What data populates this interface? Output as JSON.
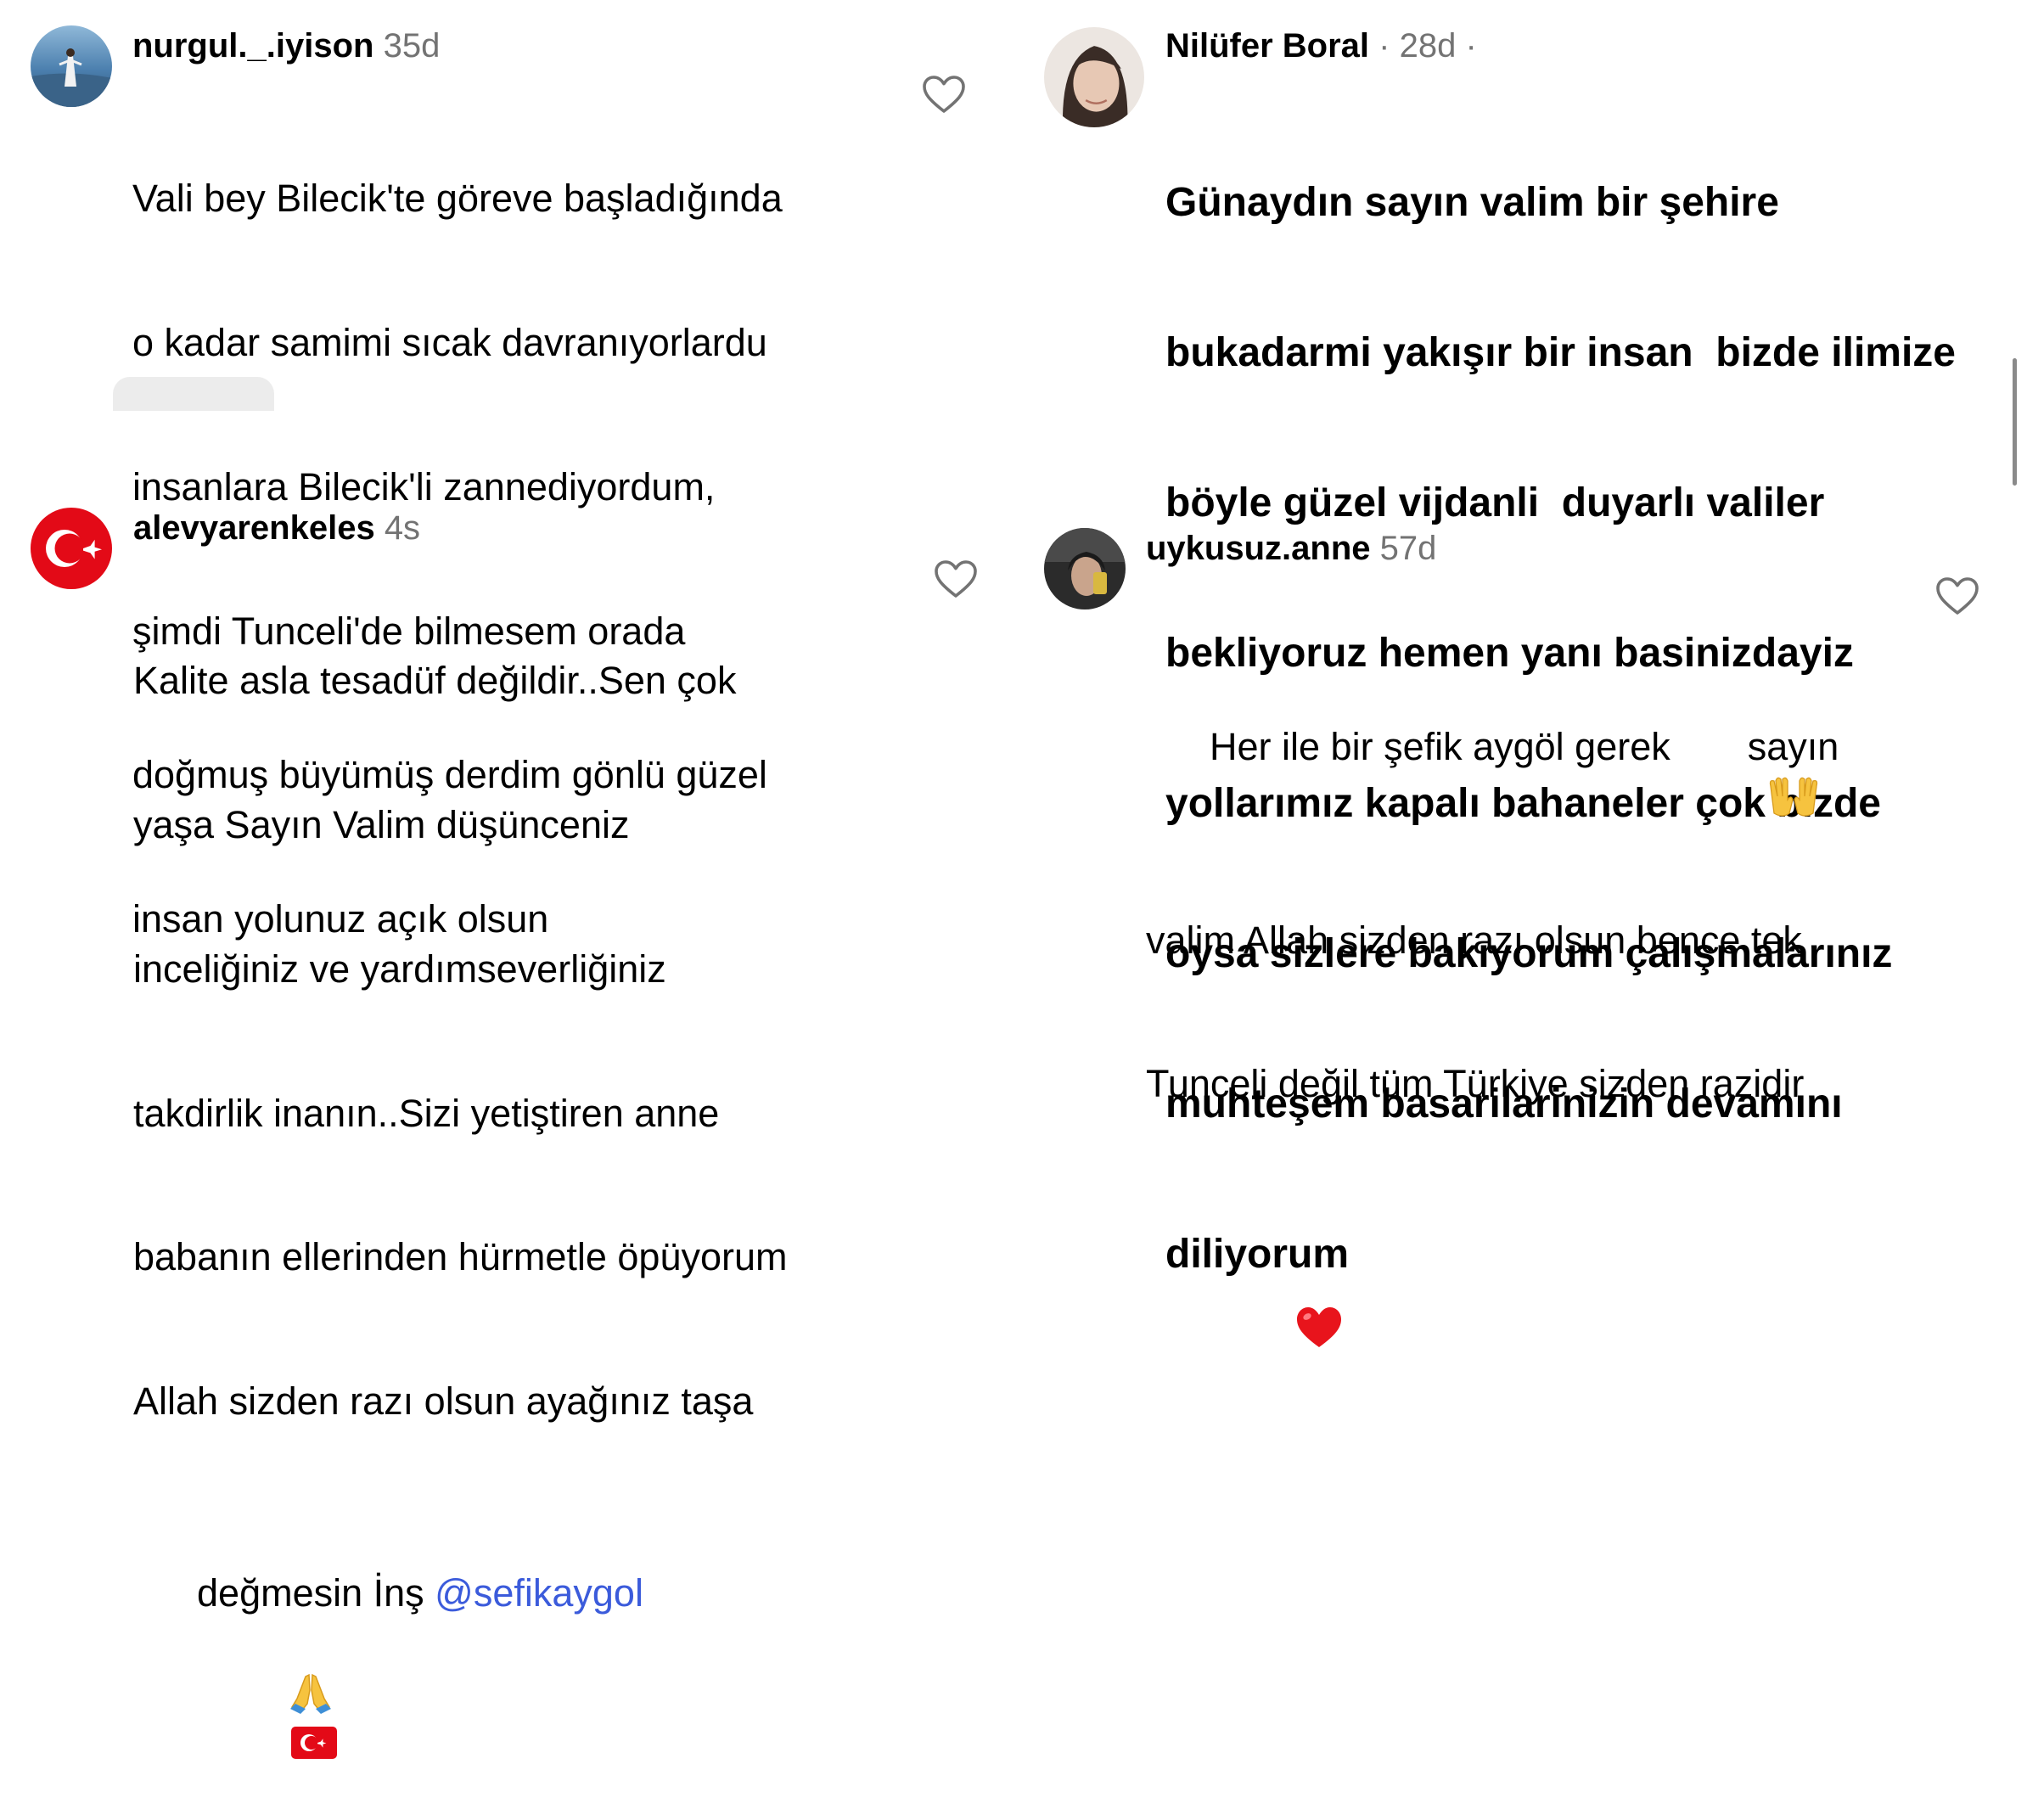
{
  "comments": [
    {
      "username": "nurgul._.iyison",
      "time": "35d",
      "lines": [
        "Vali bey Bilecik'te göreve başladığında",
        "o kadar samimi sıcak davranıyorlardu",
        "insanlara Bilecik'li zannediyordum,",
        "şimdi Tunceli'de bilmesem orada",
        "doğmuş büyümüş derdim gönlü güzel",
        "insan yolunuz açık olsun"
      ]
    },
    {
      "username": "Nilüfer Boral",
      "time": "· 28d ·",
      "lines": [
        "Günaydın sayın valim bir şehire",
        "bukadarmi yakışır bir insan  bizde ilimize",
        "böyle güzel vijdanli  duyarlı valiler",
        "bekliyoruz hemen yanı basinizdayiz",
        "yollarımız kapalı bahaneler çok bizde",
        "oysa sizlere bakıyorum çalışmalarınız",
        "muhteşem basarilarinizin devamını",
        "diliyorum"
      ]
    },
    {
      "username": "alevyarenkeles",
      "time": "4s",
      "lines": [
        "Kalite asla tesadüf değildir..Sen çok",
        "yaşa Sayın Valim düşünceniz",
        "inceliğiniz ve yardımseverliğiniz",
        "takdirlik inanın..Sizi yetiştiren anne",
        "babanın ellerinden hürmetle öpüyorum",
        "Allah sizden razı olsun ayağınız taşa"
      ],
      "last_line_text": "değmesin İnş ",
      "mention": "@sefikaygol"
    },
    {
      "username": "uykusuz.anne",
      "time": "57d",
      "line1_before": "Her ile bir şefik aygöl gerek ",
      "line1_after": " sayın",
      "lines": [
        "valim Allah sizden razı olsun bence tek",
        "Tunceli değil tüm Türkiye sizden razidir"
      ]
    }
  ],
  "icons": {
    "like": "heart-outline-icon",
    "pray": "folded-hands-emoji",
    "flag": "turkey-flag-emoji",
    "palms": "palms-up-emoji",
    "red_heart": "red-heart-emoji"
  },
  "colors": {
    "mention": "#3b5bdb",
    "timestamp": "#737373",
    "flag_red": "#e30a17"
  }
}
